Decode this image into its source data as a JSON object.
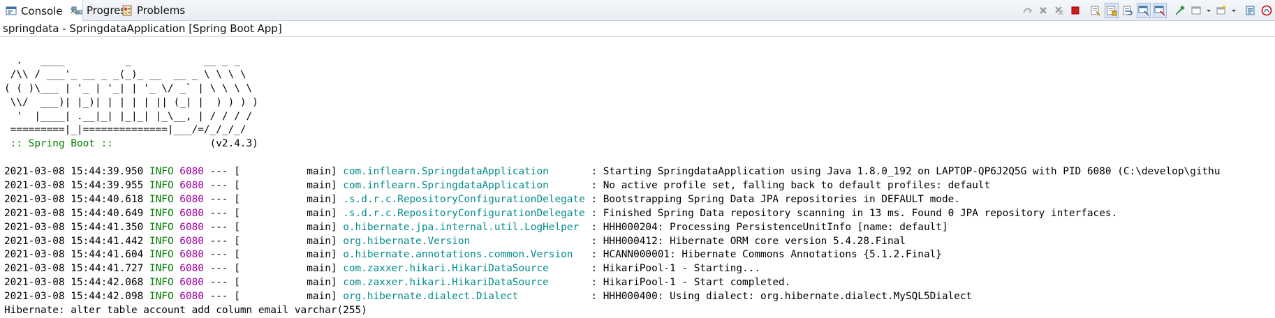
{
  "tabs": [
    {
      "label": "Console",
      "icon": "console-icon",
      "active": true
    },
    {
      "label": "Progress",
      "icon": "progress-icon",
      "active": false
    },
    {
      "label": "Problems",
      "icon": "problems-icon",
      "active": false
    }
  ],
  "toolbar": {
    "buttons": [
      "pin-console-icon",
      "terminate-icon",
      "remove-launch-icon",
      "remove-all-terminated-icon",
      "stop-icon",
      "clear-console-icon",
      "scroll-lock-icon",
      "word-wrap-icon",
      "show-on-stdout-icon",
      "show-on-stderr-icon",
      "pin-icon",
      "display-selected-console-icon",
      "display-selected-console-dropdown-icon",
      "open-console-icon",
      "open-console-dropdown-icon",
      "view-menu-icon",
      "spring-icon",
      "ant-icon"
    ]
  },
  "launch_label": "springdata - SpringdataApplication [Spring Boot App]",
  "banner": {
    "lines": [
      "  .   ____          _            __ _ _",
      " /\\\\ / ___'_ __ _ _(_)_ __  __ _ \\ \\ \\ \\",
      "( ( )\\___ | '_ | '_| | '_ \\/ _` | \\ \\ \\ \\",
      " \\\\/  ___)| |_)| | | | | || (_| |  ) ) ) )",
      "  '  |____| .__|_| |_|_| |_\\__, | / / / /",
      " =========|_|==============|___/=/_/_/_/"
    ],
    "spring_boot_label": " :: Spring Boot :: ",
    "version": "               (v2.4.3)"
  },
  "log_entries": [
    {
      "ts": "2021-03-08 15:44:39.950",
      "level": "INFO",
      "pid": "6080",
      "sep": " --- [",
      "thread": "           main]",
      "logger": "com.inflearn.SpringdataApplication      ",
      "message": " : Starting SpringdataApplication using Java 1.8.0_192 on LAPTOP-QP6J2Q5G with PID 6080 (C:\\develop\\githu"
    },
    {
      "ts": "2021-03-08 15:44:39.955",
      "level": "INFO",
      "pid": "6080",
      "sep": " --- [",
      "thread": "           main]",
      "logger": "com.inflearn.SpringdataApplication      ",
      "message": " : No active profile set, falling back to default profiles: default"
    },
    {
      "ts": "2021-03-08 15:44:40.618",
      "level": "INFO",
      "pid": "6080",
      "sep": " --- [",
      "thread": "           main]",
      "logger": ".s.d.r.c.RepositoryConfigurationDelegate",
      "message": " : Bootstrapping Spring Data JPA repositories in DEFAULT mode."
    },
    {
      "ts": "2021-03-08 15:44:40.649",
      "level": "INFO",
      "pid": "6080",
      "sep": " --- [",
      "thread": "           main]",
      "logger": ".s.d.r.c.RepositoryConfigurationDelegate",
      "message": " : Finished Spring Data repository scanning in 13 ms. Found 0 JPA repository interfaces."
    },
    {
      "ts": "2021-03-08 15:44:41.350",
      "level": "INFO",
      "pid": "6080",
      "sep": " --- [",
      "thread": "           main]",
      "logger": "o.hibernate.jpa.internal.util.LogHelper ",
      "message": " : HHH000204: Processing PersistenceUnitInfo [name: default]"
    },
    {
      "ts": "2021-03-08 15:44:41.442",
      "level": "INFO",
      "pid": "6080",
      "sep": " --- [",
      "thread": "           main]",
      "logger": "org.hibernate.Version                   ",
      "message": " : HHH000412: Hibernate ORM core version 5.4.28.Final"
    },
    {
      "ts": "2021-03-08 15:44:41.604",
      "level": "INFO",
      "pid": "6080",
      "sep": " --- [",
      "thread": "           main]",
      "logger": "o.hibernate.annotations.common.Version  ",
      "message": " : HCANN000001: Hibernate Commons Annotations {5.1.2.Final}"
    },
    {
      "ts": "2021-03-08 15:44:41.727",
      "level": "INFO",
      "pid": "6080",
      "sep": " --- [",
      "thread": "           main]",
      "logger": "com.zaxxer.hikari.HikariDataSource      ",
      "message": " : HikariPool-1 - Starting..."
    },
    {
      "ts": "2021-03-08 15:44:42.068",
      "level": "INFO",
      "pid": "6080",
      "sep": " --- [",
      "thread": "           main]",
      "logger": "com.zaxxer.hikari.HikariDataSource      ",
      "message": " : HikariPool-1 - Start completed."
    },
    {
      "ts": "2021-03-08 15:44:42.098",
      "level": "INFO",
      "pid": "6080",
      "sep": " --- [",
      "thread": "           main]",
      "logger": "org.hibernate.dialect.Dialect           ",
      "message": " : HHH000400: Using dialect: org.hibernate.dialect.MySQL5Dialect"
    }
  ],
  "hibernate_line": "Hibernate: alter table account add column email varchar(255)",
  "colors": {
    "timestamp": "#000000",
    "level": "#008000",
    "pid": "#a000a0",
    "logger": "#008b8b",
    "spring_boot_label": "#008000"
  }
}
